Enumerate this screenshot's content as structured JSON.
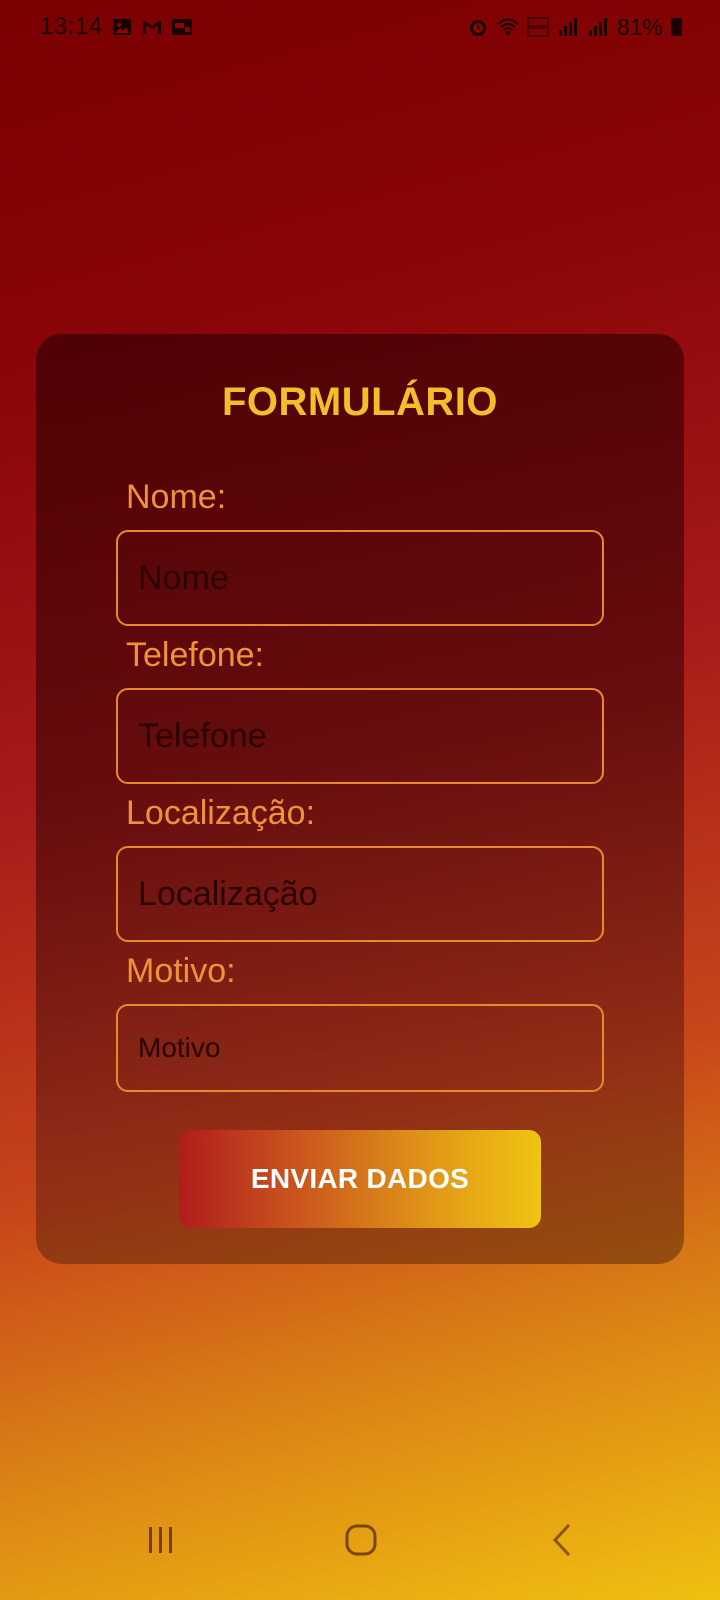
{
  "status_bar": {
    "time": "13:14",
    "battery": "81%",
    "left_icons": [
      "gallery-icon",
      "gmail-icon",
      "media-icon"
    ],
    "right_icons": [
      "alarm-icon",
      "wifi-icon",
      "volte-icon",
      "signal-icon",
      "signal-icon"
    ]
  },
  "form": {
    "title": "FORMULÁRIO",
    "fields": [
      {
        "label": "Nome:",
        "placeholder": "Nome"
      },
      {
        "label": "Telefone:",
        "placeholder": "Telefone"
      },
      {
        "label": "Localização:",
        "placeholder": "Localização"
      },
      {
        "label": "Motivo:",
        "placeholder": "Motivo"
      }
    ],
    "submit_label": "ENVIAR DADOS"
  },
  "colors": {
    "title": "#f2bf2a",
    "label": "#ee9338",
    "input_border": "#e88a2c",
    "button_start": "#b01c1c",
    "button_end": "#f0c412"
  }
}
